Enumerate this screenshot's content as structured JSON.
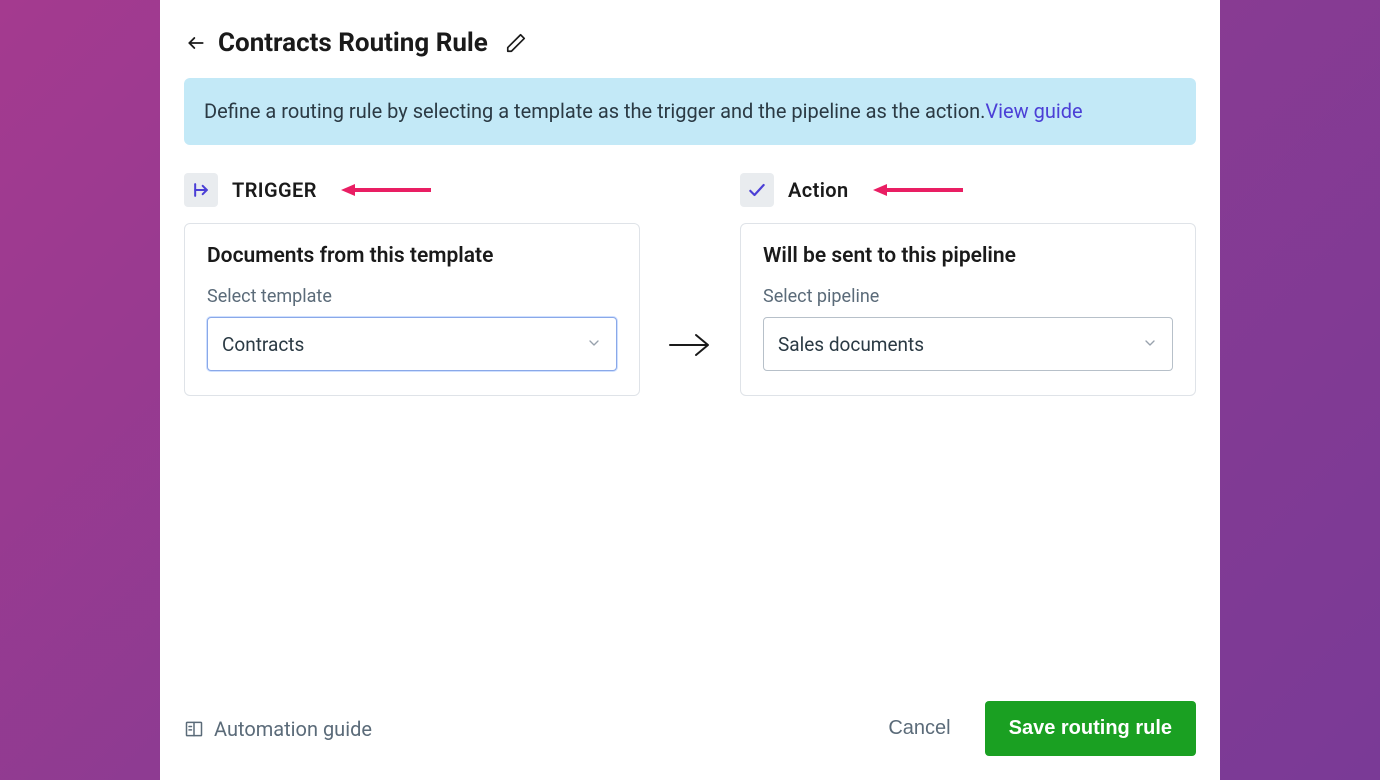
{
  "header": {
    "title": "Contracts Routing Rule"
  },
  "banner": {
    "text": "Define a routing rule by selecting a template as the trigger and the pipeline as the action.",
    "link_label": "View guide"
  },
  "trigger": {
    "section_label": "TRIGGER",
    "card_title": "Documents from this template",
    "field_label": "Select template",
    "selected_value": "Contracts"
  },
  "action": {
    "section_label": "Action",
    "card_title": "Will be sent to this pipeline",
    "field_label": "Select pipeline",
    "selected_value": "Sales documents"
  },
  "footer": {
    "guide_label": "Automation guide",
    "cancel_label": "Cancel",
    "save_label": "Save routing rule"
  },
  "colors": {
    "accent_link": "#4b3fd6",
    "save_button": "#1aa022",
    "annotation_arrow": "#e91e63"
  }
}
